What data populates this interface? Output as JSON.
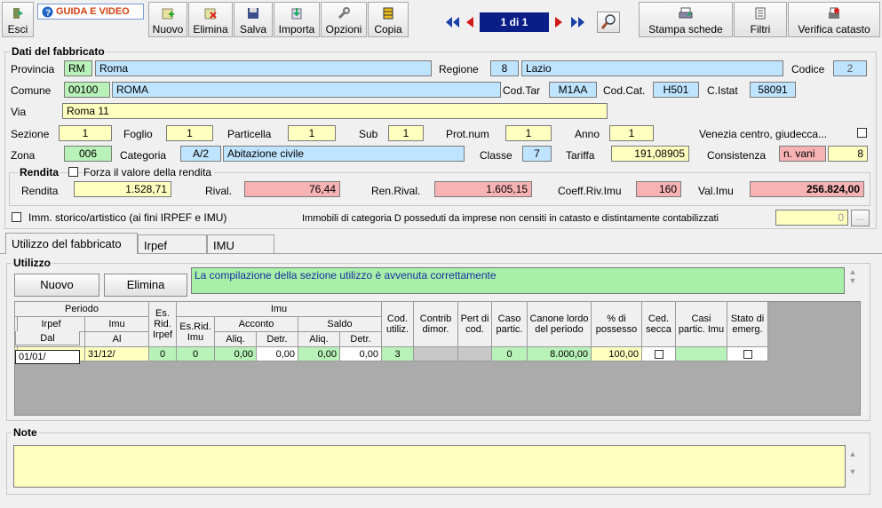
{
  "toolbar": {
    "esci": "Esci",
    "guida": "GUIDA E VIDEO",
    "nuovo": "Nuovo",
    "elimina": "Elimina",
    "salva": "Salva",
    "importa": "Importa",
    "opzioni": "Opzioni",
    "copia": "Copia",
    "record": "1 di 1",
    "stampa": "Stampa schede",
    "filtri": "Filtri",
    "verifica": "Verifica catasto"
  },
  "fabbricato": {
    "title": "Dati del fabbricato",
    "provincia_label": "Provincia",
    "provincia_code": "RM",
    "provincia": "Roma",
    "regione_label": "Regione",
    "regione_code": "8",
    "regione": "Lazio",
    "codice_label": "Codice",
    "codice": "2",
    "comune_label": "Comune",
    "cap": "00100",
    "comune": "ROMA",
    "codtar_label": "Cod.Tar",
    "codtar": "M1AA",
    "codcat_label": "Cod.Cat.",
    "codcat": "H501",
    "cistat_label": "C.Istat",
    "cistat": "58091",
    "via_label": "Via",
    "via": "Roma 11",
    "sezione_label": "Sezione",
    "sezione": "1",
    "foglio_label": "Foglio",
    "foglio": "1",
    "particella_label": "Particella",
    "particella": "1",
    "sub_label": "Sub",
    "sub": "1",
    "protnum_label": "Prot.num",
    "protnum": "1",
    "anno_label": "Anno",
    "anno": "1",
    "venezia_label": "Venezia centro, giudecca...",
    "zona_label": "Zona",
    "zona": "006",
    "categoria_label": "Categoria",
    "categoria_code": "A/2",
    "categoria": "Abitazione civile",
    "classe_label": "Classe",
    "classe": "7",
    "tariffa_label": "Tariffa",
    "tariffa": "191,08905",
    "consistenza_label": "Consistenza",
    "consistenza_unit": "n. vani",
    "consistenza": "8"
  },
  "rendita": {
    "title": "Rendita",
    "forza_label": "Forza il valore della rendita",
    "rendita_label": "Rendita",
    "rendita": "1.528,71",
    "rival_label": "Rival.",
    "rival": "76,44",
    "renrival_label": "Ren.Rival.",
    "renrival": "1.605,15",
    "coeff_label": "Coeff.Riv.Imu",
    "coeff": "160",
    "valimu_label": "Val.Imu",
    "valimu": "256.824,00"
  },
  "storico_label": "Imm. storico/artistico (ai fini IRPEF e IMU)",
  "categoriaD_label": "Immobili di categoria D posseduti da imprese non censiti in catasto e distintamente contabilizzati",
  "categoriaD_value": "0",
  "tabs": [
    "Utilizzo del fabbricato",
    "Irpef",
    "IMU"
  ],
  "utilizzo": {
    "title": "Utilizzo",
    "nuovo": "Nuovo",
    "elimina": "Elimina",
    "message": "La compilazione della sezione utilizzo è avvenuta correttamente"
  },
  "grid": {
    "h_periodo": "Periodo",
    "h_irpef": "Irpef",
    "h_imu_sub": "Imu",
    "h_dal": "Dal",
    "h_al1": "Al",
    "h_al2": "Al",
    "h_esrid_irpef": "Es. Rid. Irpef",
    "h_imu": "Imu",
    "h_esrid_imu": "Es.Rid. Imu",
    "h_acconto": "Acconto",
    "h_saldo": "Saldo",
    "h_aliq1": "Aliq.",
    "h_detr1": "Detr.",
    "h_aliq2": "Aliq.",
    "h_detr2": "Detr.",
    "h_codutil": "Cod. utiliz.",
    "h_contrib": "Contrib dimor.",
    "h_pert": "Pert di cod.",
    "h_caso": "Caso partic.",
    "h_canone": "Canone lordo del periodo",
    "h_possesso": "% di possesso",
    "h_cedsecca": "Ced. secca",
    "h_casiimu": "Casi partic. Imu",
    "h_emerg": "Stato di emerg.",
    "row": {
      "dal": "01/01/",
      "al_irpef": "31/12/",
      "al_imu": "31/12/",
      "esrid_irpef": "0",
      "esrid_imu": "0",
      "acc_aliq": "0,00",
      "acc_detr": "0,00",
      "sal_aliq": "0,00",
      "sal_detr": "0,00",
      "cod_util": "3",
      "caso": "0",
      "canone": "8.000,00",
      "possesso": "100,00"
    }
  },
  "note": {
    "title": "Note"
  }
}
